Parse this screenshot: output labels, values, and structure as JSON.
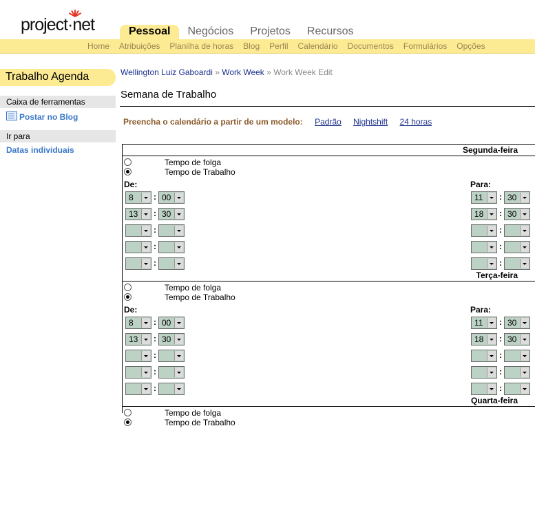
{
  "brand": {
    "logo_text": "project·net"
  },
  "main_tabs": [
    {
      "label": "Pessoal",
      "active": true
    },
    {
      "label": "Negócios",
      "active": false
    },
    {
      "label": "Projetos",
      "active": false
    },
    {
      "label": "Recursos",
      "active": false
    }
  ],
  "sub_nav": [
    "Home",
    "Atribuições",
    "Planilha de horas",
    "Blog",
    "Perfil",
    "Calendário",
    "Documentos",
    "Formulários",
    "Opções"
  ],
  "sidebar": {
    "title": "Trabalho Agenda",
    "toolbox_title": "Caixa de ferramentas",
    "blog_link": "Postar no Blog",
    "goto_title": "Ir para",
    "goto_link": "Datas individuais"
  },
  "breadcrumb": {
    "user": "Wellington Luiz Gaboardi",
    "sep": "»",
    "section": "Work Week",
    "current": "Work Week Edit"
  },
  "page_title": "Semana de Trabalho",
  "template": {
    "label": "Preencha o calendário a partir de um modelo:",
    "options": [
      "Padrão",
      "Nightshift",
      "24 horas"
    ]
  },
  "labels": {
    "from": "De:",
    "to": "Para:",
    "colon": ":",
    "off": "Tempo de folga",
    "work": "Tempo de Trabalho"
  },
  "colors": {
    "accent": "#fdeb94",
    "select_bg": "#bcd2c4",
    "link": "#1a2f8a",
    "template_label": "#8b5a2b"
  },
  "days": [
    {
      "name": "Segunda-feira",
      "mode": "work",
      "slots": [
        {
          "from_h": "8",
          "from_m": "00",
          "to_h": "11",
          "to_m": "30"
        },
        {
          "from_h": "13",
          "from_m": "30",
          "to_h": "18",
          "to_m": "30"
        },
        {
          "from_h": "",
          "from_m": "",
          "to_h": "",
          "to_m": ""
        },
        {
          "from_h": "",
          "from_m": "",
          "to_h": "",
          "to_m": ""
        },
        {
          "from_h": "",
          "from_m": "",
          "to_h": "",
          "to_m": ""
        }
      ]
    },
    {
      "name": "Terça-feira",
      "mode": "work",
      "slots": [
        {
          "from_h": "8",
          "from_m": "00",
          "to_h": "11",
          "to_m": "30"
        },
        {
          "from_h": "13",
          "from_m": "30",
          "to_h": "18",
          "to_m": "30"
        },
        {
          "from_h": "",
          "from_m": "",
          "to_h": "",
          "to_m": ""
        },
        {
          "from_h": "",
          "from_m": "",
          "to_h": "",
          "to_m": ""
        },
        {
          "from_h": "",
          "from_m": "",
          "to_h": "",
          "to_m": ""
        }
      ]
    },
    {
      "name": "Quarta-feira",
      "mode": "work",
      "slots": []
    }
  ]
}
